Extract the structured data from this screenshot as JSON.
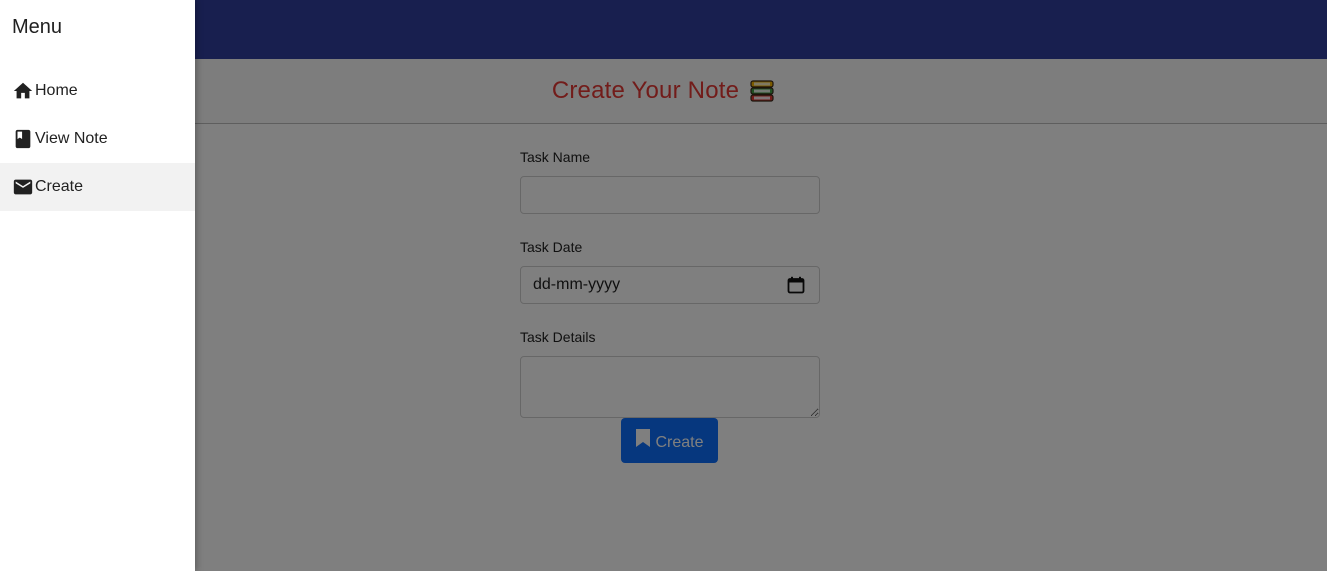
{
  "header": {
    "title": "Create Your Note",
    "title_icon": "books-icon"
  },
  "form": {
    "task_name_label": "Task Name",
    "task_name_value": "",
    "task_date_label": "Task Date",
    "task_date_placeholder": "dd-mm-yyyy",
    "task_details_label": "Task Details",
    "task_details_value": "",
    "submit_label": "Create"
  },
  "drawer": {
    "title": "Menu",
    "items": [
      {
        "label": "Home",
        "icon": "home-icon",
        "active": false
      },
      {
        "label": "View Note",
        "icon": "book-icon",
        "active": false
      },
      {
        "label": "Create",
        "icon": "mail-icon",
        "active": true
      }
    ]
  },
  "colors": {
    "topbar": "#303f9f",
    "title": "#e53935",
    "button": "#0d6efd"
  }
}
